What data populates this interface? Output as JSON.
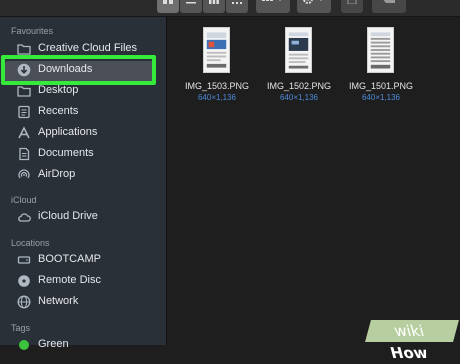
{
  "sidebar": {
    "favourites_title": "Favourites",
    "favourites": [
      {
        "label": "Creative Cloud Files",
        "icon": "folder-icon"
      },
      {
        "label": "Downloads",
        "icon": "download-icon"
      },
      {
        "label": "Desktop",
        "icon": "desktop-folder-icon"
      },
      {
        "label": "Recents",
        "icon": "recents-icon"
      },
      {
        "label": "Applications",
        "icon": "applications-icon"
      },
      {
        "label": "Documents",
        "icon": "documents-icon"
      },
      {
        "label": "AirDrop",
        "icon": "airdrop-icon"
      }
    ],
    "icloud_title": "iCloud",
    "icloud": [
      {
        "label": "iCloud Drive",
        "icon": "cloud-icon"
      }
    ],
    "locations_title": "Locations",
    "locations": [
      {
        "label": "BOOTCAMP",
        "icon": "drive-icon"
      },
      {
        "label": "Remote Disc",
        "icon": "disc-icon"
      },
      {
        "label": "Network",
        "icon": "network-icon"
      }
    ],
    "tags_title": "Tags",
    "tags": [
      {
        "label": "Green",
        "color": "#3cc43c"
      }
    ]
  },
  "files": [
    {
      "name": "IMG_1503.PNG",
      "dims": "640×1,136"
    },
    {
      "name": "IMG_1502.PNG",
      "dims": "640×1,136"
    },
    {
      "name": "IMG_1501.PNG",
      "dims": "640×1,136"
    }
  ],
  "toolbar": {
    "view_icons": [
      "icon-view-icon",
      "list-view-icon",
      "column-view-icon",
      "gallery-view-icon"
    ],
    "group_icon": "group-icon",
    "action_icon": "gear-icon",
    "share_icon": "share-icon",
    "tag_icon": "tag-icon"
  },
  "watermark": {
    "part1": "wiki",
    "part2": "How"
  },
  "colors": {
    "highlight": "#35ea3b",
    "accent": "#4d8bd9",
    "sidebar_bg": "#2a3038"
  }
}
